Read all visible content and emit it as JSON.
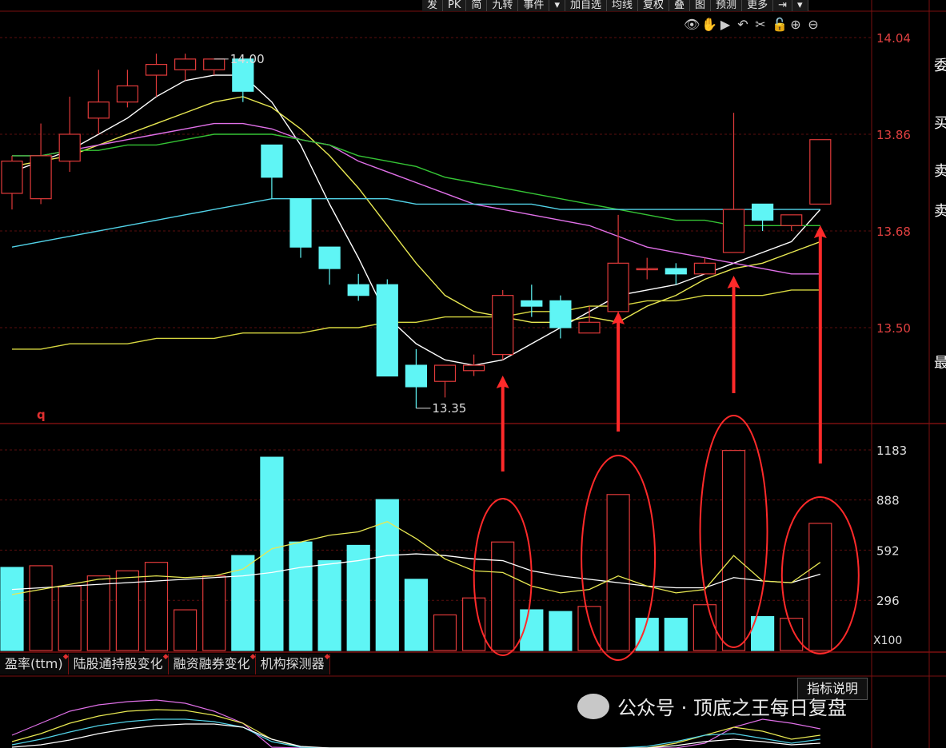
{
  "toolbar": [
    "发",
    "PK",
    "简",
    "九转",
    "事件",
    "▾",
    "加自选",
    "均线",
    "复权",
    "叠",
    "图",
    "预测",
    "更多",
    "⇥",
    "▾"
  ],
  "tools": [
    {
      "name": "eye-icon",
      "glyph": "👁"
    },
    {
      "name": "hand-icon",
      "glyph": "✋"
    },
    {
      "name": "play-icon",
      "glyph": "▶"
    },
    {
      "name": "undo-icon",
      "glyph": "↶"
    },
    {
      "name": "scissors-icon",
      "glyph": "✂"
    },
    {
      "name": "lock-icon",
      "glyph": "🔓"
    },
    {
      "name": "zoom-in-icon",
      "glyph": "⊕"
    },
    {
      "name": "zoom-out-icon",
      "glyph": "⊖"
    }
  ],
  "price_axis": [
    "14.04",
    "13.86",
    "13.68",
    "13.50"
  ],
  "volume_axis": [
    "1183",
    "888",
    "592",
    "296"
  ],
  "volume_unit": "X100",
  "marker_high": "14.00",
  "marker_low": "13.35",
  "q_label": "q",
  "tabs": [
    "盈率(ttm)",
    "陆股通持股变化",
    "融资融券变化",
    "机构探测器"
  ],
  "help_label": "指标说明",
  "watermark": "公众号 · 顶底之王每日复盘",
  "right_edge": [
    "委",
    "买",
    "卖",
    "卖",
    "最"
  ],
  "colors": {
    "up": "#e03a3a",
    "down": "#5ff5f5",
    "grid": "#5a0e0e",
    "axis": "#7a1010"
  },
  "chart_data": [
    {
      "type": "candlestick",
      "title": "",
      "ylim": [
        13.3,
        14.08
      ],
      "grid": true,
      "candles": [
        {
          "o": 13.75,
          "c": 13.81,
          "h": 13.82,
          "l": 13.72
        },
        {
          "o": 13.74,
          "c": 13.82,
          "h": 13.88,
          "l": 13.73
        },
        {
          "o": 13.81,
          "c": 13.86,
          "h": 13.93,
          "l": 13.79
        },
        {
          "o": 13.89,
          "c": 13.92,
          "h": 13.98,
          "l": 13.86
        },
        {
          "o": 13.92,
          "c": 13.95,
          "h": 13.98,
          "l": 13.91
        },
        {
          "o": 13.97,
          "c": 13.99,
          "h": 14.01,
          "l": 13.93
        },
        {
          "o": 13.98,
          "c": 14.0,
          "h": 14.01,
          "l": 13.96
        },
        {
          "o": 13.98,
          "c": 14.0,
          "h": 14.0,
          "l": 13.97
        },
        {
          "o": 14.0,
          "c": 13.94,
          "h": 14.0,
          "l": 13.92
        },
        {
          "o": 13.84,
          "c": 13.78,
          "h": 13.84,
          "l": 13.74
        },
        {
          "o": 13.74,
          "c": 13.65,
          "h": 13.74,
          "l": 13.63
        },
        {
          "o": 13.65,
          "c": 13.61,
          "h": 13.65,
          "l": 13.58
        },
        {
          "o": 13.58,
          "c": 13.56,
          "h": 13.6,
          "l": 13.55
        },
        {
          "o": 13.58,
          "c": 13.41,
          "h": 13.59,
          "l": 13.41
        },
        {
          "o": 13.43,
          "c": 13.39,
          "h": 13.46,
          "l": 13.35
        },
        {
          "o": 13.4,
          "c": 13.43,
          "h": 13.43,
          "l": 13.37
        },
        {
          "o": 13.42,
          "c": 13.43,
          "h": 13.45,
          "l": 13.41
        },
        {
          "o": 13.45,
          "c": 13.56,
          "h": 13.57,
          "l": 13.44
        },
        {
          "o": 13.55,
          "c": 13.54,
          "h": 13.58,
          "l": 13.52
        },
        {
          "o": 13.55,
          "c": 13.5,
          "h": 13.56,
          "l": 13.48
        },
        {
          "o": 13.49,
          "c": 13.51,
          "h": 13.54,
          "l": 13.49
        },
        {
          "o": 13.53,
          "c": 13.62,
          "h": 13.71,
          "l": 13.52
        },
        {
          "o": 13.61,
          "c": 13.61,
          "h": 13.63,
          "l": 13.59
        },
        {
          "o": 13.61,
          "c": 13.6,
          "h": 13.62,
          "l": 13.58
        },
        {
          "o": 13.6,
          "c": 13.62,
          "h": 13.63,
          "l": 13.6
        },
        {
          "o": 13.64,
          "c": 13.72,
          "h": 13.9,
          "l": 13.64
        },
        {
          "o": 13.73,
          "c": 13.7,
          "h": 13.73,
          "l": 13.68
        },
        {
          "o": 13.69,
          "c": 13.71,
          "h": 13.71,
          "l": 13.68
        },
        {
          "o": 13.73,
          "c": 13.85,
          "h": 13.85,
          "l": 13.73
        }
      ],
      "ma_lines": [
        {
          "color": "#ffffff",
          "values": [
            13.79,
            13.81,
            13.83,
            13.86,
            13.89,
            13.93,
            13.96,
            13.97,
            13.97,
            13.92,
            13.84,
            13.73,
            13.63,
            13.52,
            13.47,
            13.44,
            13.43,
            13.44,
            13.47,
            13.5,
            13.53,
            13.56,
            13.57,
            13.58,
            13.6,
            13.62,
            13.64,
            13.66,
            13.72
          ]
        },
        {
          "color": "#e8e852",
          "values": [
            13.8,
            13.81,
            13.82,
            13.84,
            13.86,
            13.88,
            13.9,
            13.92,
            13.93,
            13.91,
            13.87,
            13.82,
            13.76,
            13.69,
            13.62,
            13.56,
            13.53,
            13.52,
            13.51,
            13.51,
            13.52,
            13.51,
            13.54,
            13.56,
            13.59,
            13.61,
            13.62,
            13.64,
            13.66
          ]
        },
        {
          "color": "#e070e8",
          "values": [
            13.82,
            13.82,
            13.83,
            13.84,
            13.85,
            13.86,
            13.87,
            13.88,
            13.88,
            13.87,
            13.85,
            13.84,
            13.81,
            13.79,
            13.77,
            13.75,
            13.73,
            13.72,
            13.71,
            13.7,
            13.69,
            13.67,
            13.65,
            13.64,
            13.63,
            13.62,
            13.61,
            13.6,
            13.6
          ]
        },
        {
          "color": "#35c435",
          "values": [
            13.82,
            13.82,
            13.83,
            13.83,
            13.84,
            13.84,
            13.85,
            13.86,
            13.86,
            13.86,
            13.85,
            13.84,
            13.82,
            13.81,
            13.8,
            13.78,
            13.77,
            13.76,
            13.75,
            13.74,
            13.73,
            13.72,
            13.71,
            13.7,
            13.7,
            13.69,
            13.69,
            13.69,
            13.69
          ]
        },
        {
          "color": "#52d3e8",
          "values": [
            13.65,
            13.66,
            13.67,
            13.68,
            13.69,
            13.7,
            13.71,
            13.72,
            13.73,
            13.74,
            13.74,
            13.74,
            13.74,
            13.74,
            13.73,
            13.73,
            13.73,
            13.73,
            13.73,
            13.72,
            13.72,
            13.72,
            13.72,
            13.72,
            13.72,
            13.72,
            13.72,
            13.72,
            13.72
          ]
        },
        {
          "color": "#d8d840",
          "values": [
            13.46,
            13.46,
            13.47,
            13.47,
            13.47,
            13.48,
            13.48,
            13.48,
            13.49,
            13.49,
            13.49,
            13.5,
            13.5,
            13.51,
            13.51,
            13.52,
            13.52,
            13.52,
            13.53,
            13.53,
            13.54,
            13.54,
            13.55,
            13.55,
            13.56,
            13.56,
            13.56,
            13.57,
            13.57
          ]
        }
      ],
      "annotations": [
        {
          "text": "14.00",
          "at_candle": 7,
          "value": 14.0
        },
        {
          "text": "13.35",
          "at_candle": 14,
          "value": 13.35
        }
      ],
      "arrows_at_candles": [
        17,
        21,
        25,
        28
      ]
    },
    {
      "type": "bar",
      "title": "",
      "ylabel": "X100",
      "ylim": [
        0,
        1183
      ],
      "values": [
        490,
        500,
        380,
        440,
        470,
        520,
        240,
        440,
        560,
        1140,
        640,
        530,
        620,
        890,
        420,
        210,
        310,
        640,
        240,
        230,
        260,
        920,
        190,
        190,
        270,
        1180,
        200,
        190,
        750
      ],
      "up": [
        false,
        true,
        true,
        true,
        true,
        true,
        true,
        true,
        false,
        false,
        false,
        false,
        false,
        false,
        false,
        true,
        true,
        true,
        false,
        false,
        true,
        true,
        false,
        false,
        true,
        true,
        false,
        true,
        true
      ],
      "ma_white": [
        360,
        370,
        380,
        390,
        400,
        410,
        420,
        430,
        440,
        460,
        490,
        510,
        530,
        560,
        570,
        560,
        540,
        530,
        470,
        440,
        420,
        400,
        380,
        370,
        370,
        430,
        410,
        400,
        450
      ],
      "ma_yellow": [
        330,
        360,
        390,
        420,
        430,
        440,
        430,
        440,
        480,
        600,
        640,
        680,
        700,
        760,
        660,
        540,
        470,
        460,
        380,
        340,
        360,
        440,
        380,
        340,
        360,
        560,
        410,
        400,
        520
      ],
      "circled_bars": [
        17,
        21,
        25,
        28
      ]
    }
  ]
}
